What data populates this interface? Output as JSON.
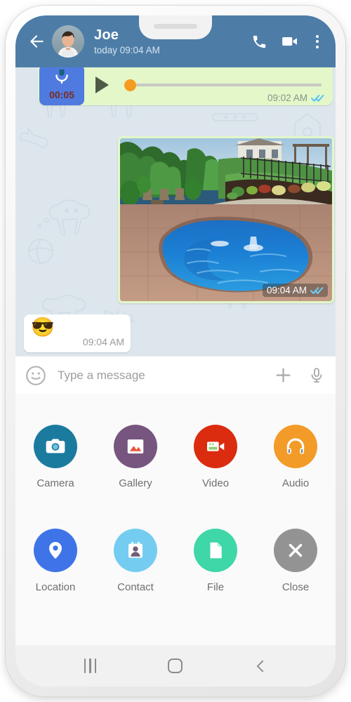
{
  "app": {
    "type": "messaging-chat",
    "platform": "android",
    "header_color": "#4d7da7",
    "outgoing_bubble_color": "#e3f7c9",
    "incoming_bubble_color": "#ffffff",
    "chat_background_color": "#dde6ec"
  },
  "appbar": {
    "back_icon": "arrow-left-icon",
    "avatar_alt": "contact-avatar-photo",
    "name": "Joe",
    "status": "today 09:04 AM",
    "call_icon": "phone-icon",
    "video_call_icon": "video-camera-icon",
    "overflow_icon": "more-vertical-icon"
  },
  "messages": [
    {
      "id": "voice-message",
      "kind": "voice",
      "direction": "outgoing",
      "duration": "00:05",
      "play_icon": "play-triangle-icon",
      "mic_icon": "microphone-icon",
      "progress_percent": 0,
      "thumb_color": "#f59c20",
      "time": "09:02 AM",
      "receipt": "read",
      "receipt_icon": "double-check-icon"
    },
    {
      "id": "photo-message",
      "kind": "image",
      "direction": "outgoing",
      "image_alt": "backyard-swimming-pool-with-waterfalls",
      "time": "09:04 AM",
      "receipt": "read",
      "receipt_icon": "double-check-icon"
    },
    {
      "id": "emoji-message",
      "kind": "emoji",
      "direction": "incoming",
      "emoji": "😎",
      "time": "09:04 AM"
    }
  ],
  "composer": {
    "emoji_icon": "smiley-face-icon",
    "placeholder": "Type a message",
    "value": "",
    "attach_icon": "plus-icon",
    "mic_icon": "microphone-icon"
  },
  "attachment_sheet": {
    "rows": [
      [
        {
          "label": "Camera",
          "icon": "camera-icon",
          "color": "#1b7b9e"
        },
        {
          "label": "Gallery",
          "icon": "image-icon",
          "color": "#76557f"
        },
        {
          "label": "Video",
          "icon": "video-camera-icon",
          "color": "#db2c10"
        },
        {
          "label": "Audio",
          "icon": "headphones-icon",
          "color": "#f29b28"
        }
      ],
      [
        {
          "label": "Location",
          "icon": "map-pin-icon",
          "color": "#3f74e8"
        },
        {
          "label": "Contact",
          "icon": "contact-card-icon",
          "color": "#74cdf0"
        },
        {
          "label": "File",
          "icon": "document-icon",
          "color": "#3fd6a8"
        },
        {
          "label": "Close",
          "icon": "close-x-icon",
          "color": "#939393"
        }
      ]
    ]
  },
  "navbar": {
    "recents_icon": "recents-icon",
    "home_icon": "home-icon",
    "back_icon": "back-chevron-icon"
  }
}
